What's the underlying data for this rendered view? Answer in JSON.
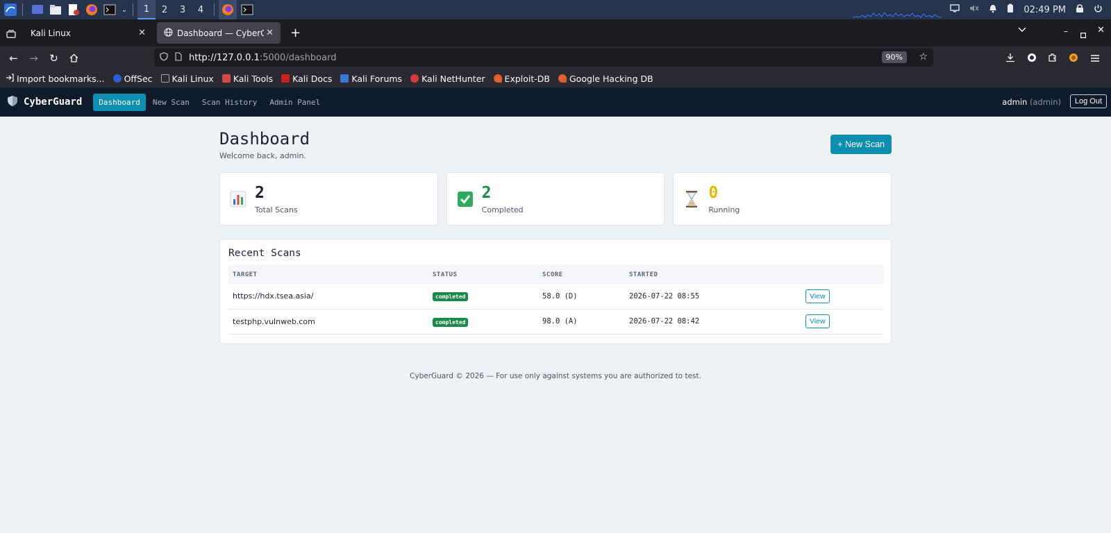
{
  "taskbar": {
    "workspaces": [
      "1",
      "2",
      "3",
      "4"
    ],
    "active_workspace": "1",
    "clock": "02:49 PM",
    "icons": [
      "kali-menu-icon",
      "desktop-icon",
      "file-manager-icon",
      "text-editor-icon",
      "firefox-icon",
      "terminal-icon",
      "chevron-down-icon"
    ]
  },
  "browser": {
    "tabs": [
      {
        "title": "Kali Linux",
        "active": false
      },
      {
        "title": "Dashboard — CyberGuard",
        "active": true
      }
    ],
    "url": "http://127.0.0.1:5000/dashboard",
    "url_host": "http://127.0.0.1",
    "url_rest": ":5000/dashboard",
    "zoom": "90%",
    "bookmarks": [
      "Import bookmarks...",
      "OffSec",
      "Kali Linux",
      "Kali Tools",
      "Kali Docs",
      "Kali Forums",
      "Kali NetHunter",
      "Exploit-DB",
      "Google Hacking DB"
    ]
  },
  "app": {
    "brand": "CyberGuard",
    "nav": [
      "Dashboard",
      "New Scan",
      "Scan History",
      "Admin Panel"
    ],
    "active_nav": "Dashboard",
    "user": "admin",
    "role": "(admin)",
    "logout_label": "Log Out"
  },
  "dashboard": {
    "title": "Dashboard",
    "welcome": "Welcome back, admin.",
    "new_scan_label": "+ New Scan",
    "stats": [
      {
        "value": "2",
        "label": "Total Scans",
        "icon": "bar-chart-icon",
        "color": "#1b2232"
      },
      {
        "value": "2",
        "label": "Completed",
        "icon": "check-mark-icon",
        "color": "#1a8a4a"
      },
      {
        "value": "0",
        "label": "Running",
        "icon": "hourglass-icon",
        "color": "#e6b800"
      }
    ],
    "recent_title": "Recent Scans",
    "columns": [
      "TARGET",
      "STATUS",
      "SCORE",
      "STARTED",
      ""
    ],
    "rows": [
      {
        "target": "https://hdx.tsea.asia/",
        "status": "completed",
        "score": "58.0 (D)",
        "started": "2026-07-22 08:55",
        "action": "View"
      },
      {
        "target": "testphp.vulnweb.com",
        "status": "completed",
        "score": "98.0 (A)",
        "started": "2026-07-22 08:42",
        "action": "View"
      }
    ]
  },
  "footer": "CyberGuard © 2026 — For use only against systems you are authorized to test.",
  "colors": {
    "accent": "#0e8fb1",
    "nav_bg": "#0f1a2b",
    "completed": "#1a8a4a",
    "running": "#e6b800"
  }
}
